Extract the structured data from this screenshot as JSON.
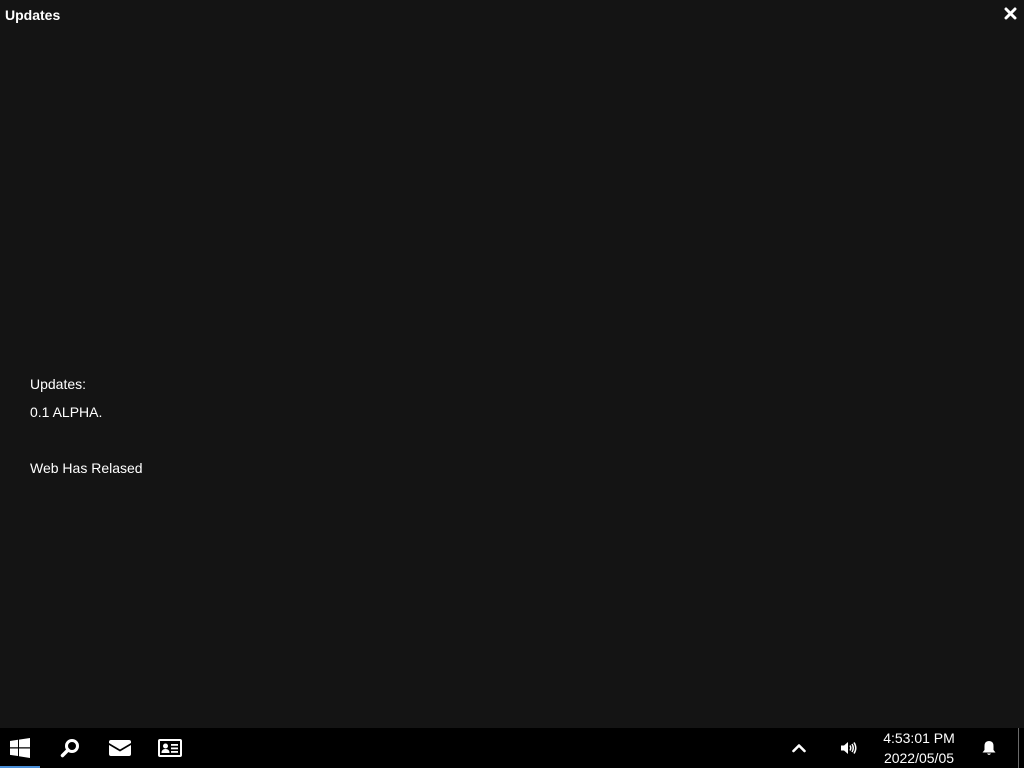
{
  "window": {
    "title": "Updates",
    "close_icon": "close-icon"
  },
  "content": {
    "lines": [
      "Updates:",
      "0.1 ALPHA.",
      "Web Has Relased"
    ]
  },
  "taskbar": {
    "icons": [
      "windows-start-icon",
      "search-icon",
      "mail-icon",
      "contact-card-icon",
      "chevron-up-icon",
      "volume-icon",
      "bell-icon"
    ],
    "clock": {
      "time": "4:53:01 PM",
      "date": "2022/05/05"
    },
    "accent": "#4a8fd8"
  }
}
